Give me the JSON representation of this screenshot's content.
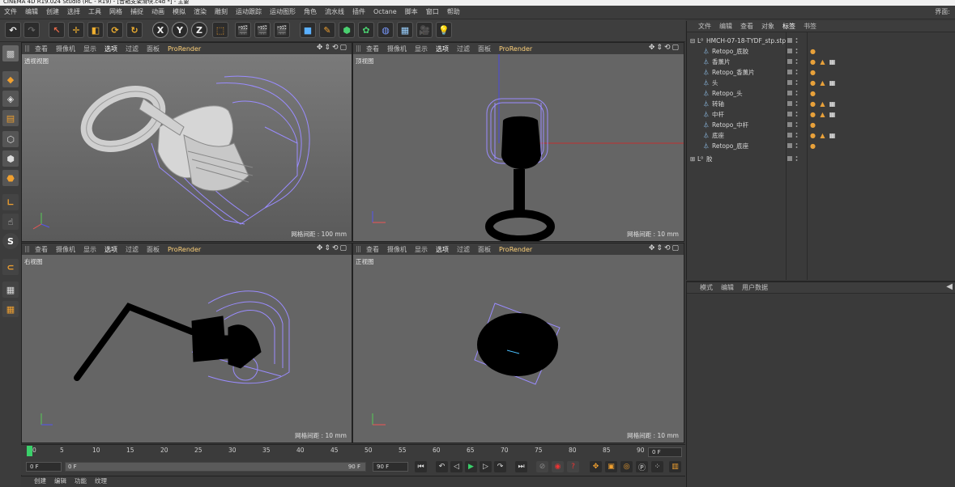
{
  "window_title": "CINEMA 4D R19.024 Studio (RC - R19) - [音箱支架滑块.c4d *] - 主要",
  "menu": [
    "文件",
    "编辑",
    "创建",
    "选择",
    "工具",
    "网格",
    "捕捉",
    "动画",
    "模拟",
    "渲染",
    "雕刻",
    "运动跟踪",
    "运动图形",
    "角色",
    "流水线",
    "插件",
    "Octane",
    "脚本",
    "窗口",
    "帮助"
  ],
  "layout_label": "界面:",
  "toolbar": {
    "axis_x": "X",
    "axis_y": "Y",
    "axis_z": "Z"
  },
  "viewport_menu": [
    "查看",
    "摄像机",
    "显示",
    "选项",
    "过滤",
    "面板",
    "ProRender"
  ],
  "viewports": [
    {
      "label": "透视视图",
      "grid": "网格间距 : 100 mm"
    },
    {
      "label": "顶视图",
      "grid": "网格间距 : 10 mm"
    },
    {
      "label": "右视图",
      "grid": "网格间距 : 10 mm"
    },
    {
      "label": "正视图",
      "grid": "网格间距 : 10 mm"
    }
  ],
  "object_manager": {
    "menu": [
      "文件",
      "编辑",
      "查看",
      "对象",
      "标签",
      "书签"
    ],
    "root": "HMCH-07-18-TYDF_stp.stp",
    "items": [
      {
        "name": "Retopo_底胶",
        "tags": 1
      },
      {
        "name": "香薰片",
        "tags": 3
      },
      {
        "name": "Retopo_香薰片",
        "tags": 1
      },
      {
        "name": "头",
        "tags": 3
      },
      {
        "name": "Retopo_头",
        "tags": 1
      },
      {
        "name": "转轴",
        "tags": 3
      },
      {
        "name": "中杆",
        "tags": 3
      },
      {
        "name": "Retopo_中杆",
        "tags": 1
      },
      {
        "name": "底座",
        "tags": 3
      },
      {
        "name": "Retopo_底座",
        "tags": 1
      }
    ],
    "extra": "胶"
  },
  "attribute_manager": {
    "menu": [
      "模式",
      "编辑",
      "用户数据"
    ]
  },
  "timeline": {
    "ticks": [
      "0",
      "5",
      "10",
      "15",
      "20",
      "25",
      "30",
      "35",
      "40",
      "45",
      "50",
      "55",
      "60",
      "65",
      "70",
      "75",
      "80",
      "85",
      "90"
    ],
    "current_frame": "0 F"
  },
  "transport": {
    "start": "0 F",
    "range_start": "0 F",
    "range_end": "90 F",
    "end": "90 F"
  },
  "bottom_menu": [
    "创建",
    "编辑",
    "功能",
    "纹理"
  ],
  "colors": {
    "accent": "#e8a13a",
    "wire": "#9a8cff",
    "selected_tab": "#ffffff"
  }
}
